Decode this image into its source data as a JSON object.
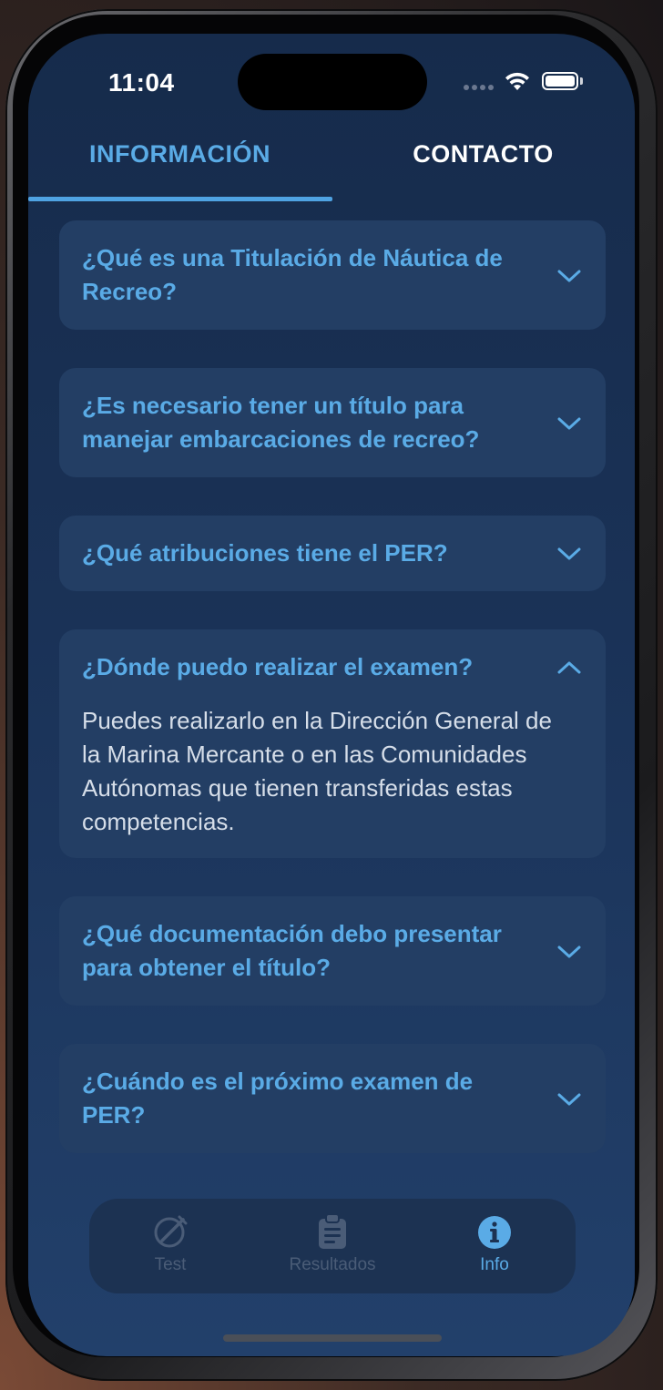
{
  "status_bar": {
    "time": "11:04",
    "icons": [
      "cellular-signal-icon",
      "wifi-icon",
      "battery-icon"
    ]
  },
  "top_tabs": [
    {
      "label": "INFORMACIÓN",
      "selected": true
    },
    {
      "label": "CONTACTO",
      "selected": false
    }
  ],
  "faq": [
    {
      "question": "¿Qué es una Titulación de Náutica de Recreo?",
      "expanded": false
    },
    {
      "question": "¿Es necesario tener un título para manejar embarcaciones de recreo?",
      "expanded": false
    },
    {
      "question": "¿Qué atribuciones tiene el PER?",
      "expanded": false
    },
    {
      "question": "¿Dónde puedo realizar el examen?",
      "expanded": true,
      "answer": "Puedes realizarlo en la Dirección General de la Marina Mercante o en las Comunidades Autónomas que tienen transferidas estas competencias."
    },
    {
      "question": "¿Qué documentación debo presentar para obtener el título?",
      "expanded": false
    },
    {
      "question": "¿Cuándo es el próximo examen de PER?",
      "expanded": false
    }
  ],
  "bottom_tabs": [
    {
      "label": "Test",
      "icon": "compass-pencil-icon",
      "selected": false
    },
    {
      "label": "Resultados",
      "icon": "clipboard-icon",
      "selected": false
    },
    {
      "label": "Info",
      "icon": "info-icon",
      "selected": true
    }
  ],
  "colors": {
    "accent": "#5aabe6",
    "background_top": "#162b4b",
    "background_bottom": "#22406b",
    "card": "#233e64",
    "answer_text": "#d6dee9",
    "inactive_tab": "#4a5c77"
  }
}
